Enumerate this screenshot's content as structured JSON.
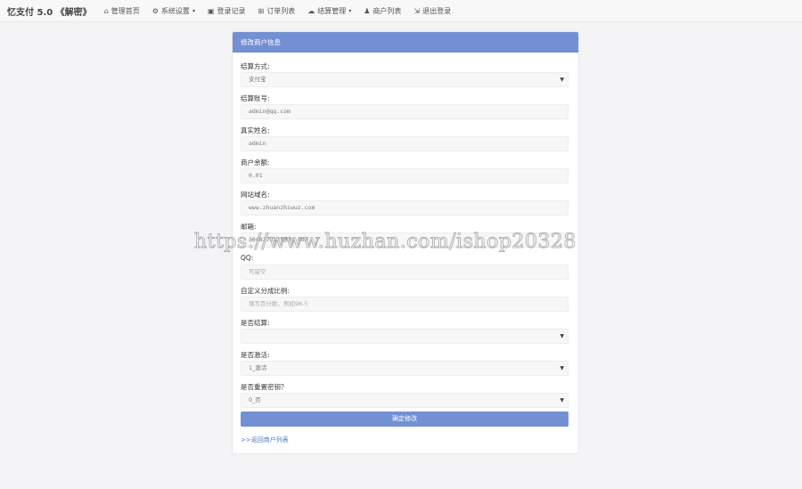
{
  "navbar": {
    "brand": "忆支付 5.0 《解密》",
    "items": [
      {
        "icon": "home-icon",
        "glyph": "⌂",
        "label": "管理首页",
        "dropdown": false
      },
      {
        "icon": "gear-icon",
        "glyph": "⚙",
        "label": "系统设置",
        "dropdown": true
      },
      {
        "icon": "camera-icon",
        "glyph": "▣",
        "label": "登录记录",
        "dropdown": false
      },
      {
        "icon": "cart-icon",
        "glyph": "⊞",
        "label": "订单列表",
        "dropdown": false
      },
      {
        "icon": "cloud-icon",
        "glyph": "☁",
        "label": "结算管理",
        "dropdown": true
      },
      {
        "icon": "user-icon",
        "glyph": "♟",
        "label": "商户列表",
        "dropdown": false
      },
      {
        "icon": "logout-icon",
        "glyph": "⇲",
        "label": "退出登录",
        "dropdown": false
      }
    ]
  },
  "panel": {
    "title": "修改商户信息",
    "fields": [
      {
        "label": "结算方式:",
        "value": "支付宝",
        "type": "select"
      },
      {
        "label": "结算账号:",
        "value": "admin@qq.com",
        "type": "text"
      },
      {
        "label": "真实姓名:",
        "value": "admin",
        "type": "text"
      },
      {
        "label": "商户余额:",
        "value": "0.01",
        "type": "text"
      },
      {
        "label": "网站域名:",
        "value": "www.zhuanzhiwuz.com",
        "type": "text"
      },
      {
        "label": "邮箱:",
        "value": "1048378125@qq.com",
        "type": "text"
      },
      {
        "label": "QQ:",
        "value": "可留空",
        "type": "placeholder"
      },
      {
        "label": "自定义分成比例:",
        "value": "填写百分数，例如98.5",
        "type": "placeholder"
      },
      {
        "label": "是否结算:",
        "value": "",
        "type": "select"
      },
      {
        "label": "是否激活:",
        "value": "1_激活",
        "type": "select"
      },
      {
        "label": "是否重置密钥？",
        "value": "0_否",
        "type": "select"
      }
    ],
    "submit_label": "确定修改",
    "back_link": ">>返回商户列表"
  },
  "watermark": "https://www.huzhan.com/ishop20328",
  "colors": {
    "accent": "#7490d4",
    "link": "#4a7cc4",
    "background": "#f4f4f6"
  }
}
